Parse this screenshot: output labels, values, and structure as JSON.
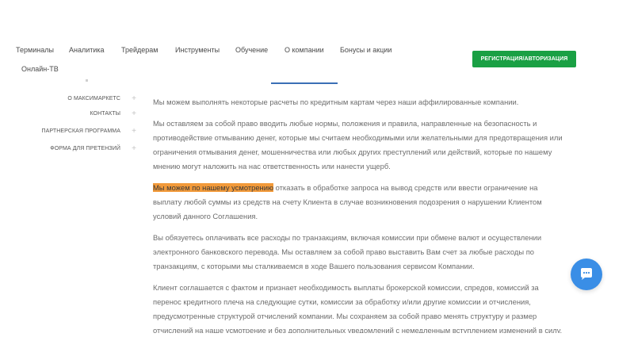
{
  "nav": {
    "items": [
      "Терминалы",
      "Аналитика",
      "Трейдерам",
      "Инструменты",
      "Обучение",
      "О компании",
      "Бонусы и акции"
    ],
    "second_row_item": "Онлайн-ТВ",
    "register_button": "РЕГИСТРАЦИЯ/АВТОРИЗАЦИЯ",
    "active_item": "О компании"
  },
  "sidebar": {
    "items": [
      "О МАКСИМАРКЕТС",
      "КОНТАКТЫ",
      "ПАРТНЕРСКАЯ ПРОГРАММА",
      "ФОРМА ДЛЯ ПРЕТЕНЗИЙ"
    ]
  },
  "content": {
    "p1": "Мы можем выполнять некоторые расчеты по кредитным картам через наши аффилированные компании.",
    "p2": "Мы оставляем за собой право вводить любые нормы, положения и правила, направленные на безопасность и противодействие отмыванию денег, которые мы считаем необходимыми или желательными для предотвращения или ограничения отмывания денег, мошенничества или любых других преступлений или действий, которые по нашему мнению могут наложить на нас ответственность или нанести ущерб.",
    "p3_highlight": "Мы можем по нашему усмотрению",
    "p3_rest": " отказать в обработке запроса на вывод средств или ввести ограничение на выплату любой суммы из средств на счету Клиента в случае возникновения подозрения о нарушении Клиентом условий данного Соглашения.",
    "p4": "Вы обязуетесь оплачивать все расходы по транзакциям, включая комиссии при обмене валют и осуществлении электронного банковского перевода. Мы оставляем за собой право выставить Вам счет за любые расходы по транзакциям, с которыми мы сталкиваемся в ходе Вашего пользования сервисом Компании.",
    "p5": "Клиент соглашается с фактом и признает необходимость выплаты брокерской комиссии, спредов, комиссий за перенос кредитного плеча на следующие сутки, комиссии за обработку и/или другие комиссии и отчисления, предусмотренные структурой отчислений компании. Мы сохраняем за собой право менять структуру и размер отчислений на наше усмотрение и без дополнительных уведомлений с немедленным вступлением изменений в силу."
  },
  "colors": {
    "accent_green": "#1aa044",
    "accent_blue": "#3a8ee6",
    "highlight_orange": "#f29a3a",
    "nav_underline": "#3b6fb6"
  },
  "chat": {
    "icon": "chat-bubble-icon"
  }
}
